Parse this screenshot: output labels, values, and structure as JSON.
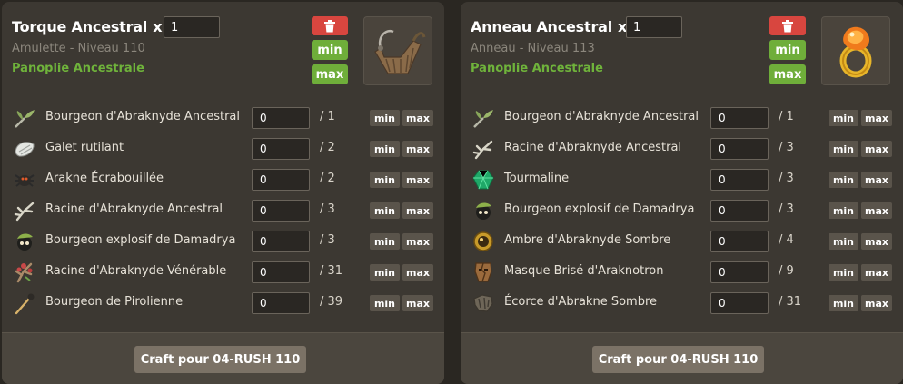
{
  "panels": [
    {
      "title": "Torque Ancestral",
      "x_label": "x",
      "quantity": "1",
      "subtitle": "Amulette - Niveau 110",
      "set": "Panoplie Ancestrale",
      "min_label": "min",
      "max_label": "max",
      "item_icon": "torque-amulet-image",
      "resources": [
        {
          "icon": "bourgeon-ancestral-icon",
          "name": "Bourgeon d'Abraknyde Ancestral",
          "value": "0",
          "total": "/ 1"
        },
        {
          "icon": "galet-rutilant-icon",
          "name": "Galet rutilant",
          "value": "0",
          "total": "/ 2"
        },
        {
          "icon": "arakne-ecrabouillee-icon",
          "name": "Arakne Écrabouillée",
          "value": "0",
          "total": "/ 2"
        },
        {
          "icon": "racine-ancestral-icon",
          "name": "Racine d'Abraknyde Ancestral",
          "value": "0",
          "total": "/ 3"
        },
        {
          "icon": "bourgeon-explosif-icon",
          "name": "Bourgeon explosif de Damadrya",
          "value": "0",
          "total": "/ 3"
        },
        {
          "icon": "racine-venerable-icon",
          "name": "Racine d'Abraknyde Vénérable",
          "value": "0",
          "total": "/ 31"
        },
        {
          "icon": "bourgeon-pirolienne-icon",
          "name": "Bourgeon de Pirolienne",
          "value": "0",
          "total": "/ 39"
        }
      ],
      "row_min": "min",
      "row_max": "max",
      "craft_label": "Craft pour 04-RUSH 110"
    },
    {
      "title": "Anneau Ancestral",
      "x_label": "x",
      "quantity": "1",
      "subtitle": "Anneau - Niveau 113",
      "set": "Panoplie Ancestrale",
      "min_label": "min",
      "max_label": "max",
      "item_icon": "anneau-ring-image",
      "resources": [
        {
          "icon": "bourgeon-ancestral-icon",
          "name": "Bourgeon d'Abraknyde Ancestral",
          "value": "0",
          "total": "/ 1"
        },
        {
          "icon": "racine-ancestral-icon",
          "name": "Racine d'Abraknyde Ancestral",
          "value": "0",
          "total": "/ 3"
        },
        {
          "icon": "tourmaline-icon",
          "name": "Tourmaline",
          "value": "0",
          "total": "/ 3"
        },
        {
          "icon": "bourgeon-explosif-icon",
          "name": "Bourgeon explosif de Damadrya",
          "value": "0",
          "total": "/ 3"
        },
        {
          "icon": "ambre-sombre-icon",
          "name": "Ambre d'Abraknyde Sombre",
          "value": "0",
          "total": "/ 4"
        },
        {
          "icon": "masque-brise-icon",
          "name": "Masque Brisé d'Araknotron",
          "value": "0",
          "total": "/ 9"
        },
        {
          "icon": "ecorce-sombre-icon",
          "name": "Écorce d'Abrakne Sombre",
          "value": "0",
          "total": "/ 31"
        }
      ],
      "row_min": "min",
      "row_max": "max",
      "craft_label": "Craft pour 04-RUSH 110"
    }
  ],
  "colors": {
    "delete": "#d8463f",
    "green": "#6fae3a",
    "set_text": "#6fb33b",
    "panel": "#3c3832"
  }
}
